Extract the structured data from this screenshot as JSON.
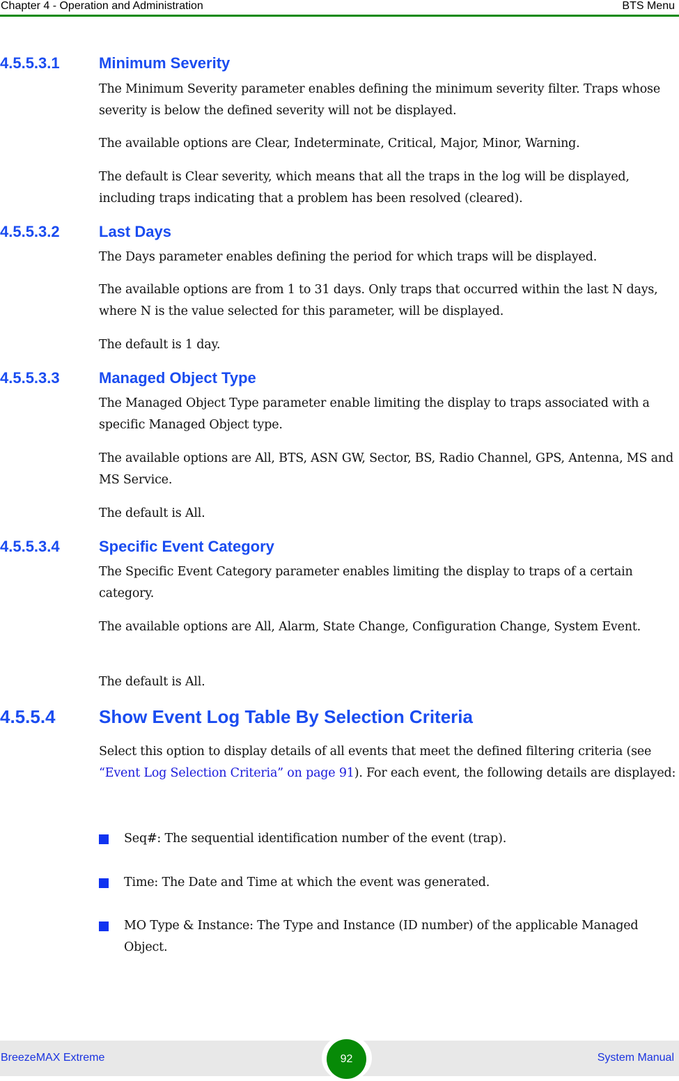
{
  "header": {
    "chapter": "Chapter 4 - Operation and Administration",
    "section": "BTS Menu",
    "rule_color": "#0a8a0a"
  },
  "sections": [
    {
      "number": "4.5.5.3.1",
      "title": "Minimum Severity",
      "paragraphs": [
        "The Minimum Severity parameter enables defining the minimum severity filter. Traps whose severity is below the defined severity will not be displayed.",
        "The available options are Clear, Indeterminate, Critical, Major, Minor, Warning.",
        "The default is Clear severity, which means that all the traps in the log will be displayed, including traps indicating that a problem has been resolved (cleared)."
      ]
    },
    {
      "number": "4.5.5.3.2",
      "title": "Last Days",
      "paragraphs": [
        "The Days parameter enables defining the period for which traps will be displayed.",
        "The available options are from 1 to 31 days. Only traps that occurred within the last N days, where N is the value selected for this parameter, will be displayed.",
        "The default is 1 day."
      ]
    },
    {
      "number": "4.5.5.3.3",
      "title": "Managed Object Type",
      "paragraphs": [
        "The Managed Object Type parameter enable limiting the display to traps associated with a specific Managed Object type.",
        "The available options are All, BTS, ASN GW, Sector, BS, Radio Channel, GPS, Antenna, MS and MS Service.",
        "The default is All."
      ]
    },
    {
      "number": "4.5.5.3.4",
      "title": "Specific Event Category",
      "paragraphs": [
        "The Specific Event Category parameter enables limiting the display to traps of a certain category.",
        "The available options are All, Alarm, State Change, Configuration Change, System Event.",
        "The default is All."
      ]
    },
    {
      "number": "4.5.5.4",
      "title": "Show Event Log Table By Selection Criteria",
      "intro_before_link": "Select this option to display details of all events that meet the defined filtering criteria (see ",
      "link_text": "“Event Log Selection Criteria” on page 91",
      "intro_after_link": "). For each event, the following details are displayed:",
      "bullets": [
        "Seq#: The sequential identification number of the event (trap).",
        "Time: The Date and Time at which the event was generated.",
        "MO Type & Instance: The Type and Instance (ID number) of the applicable Managed Object."
      ]
    }
  ],
  "footer": {
    "product": "BreezeMAX Extreme",
    "page_number": "92",
    "doc_type": "System Manual"
  },
  "colors": {
    "heading": "#1a4cf0",
    "link": "#1a1adb",
    "bullet": "#1033f0",
    "footer_text": "#1a33e0",
    "page_badge": "#078a07"
  }
}
